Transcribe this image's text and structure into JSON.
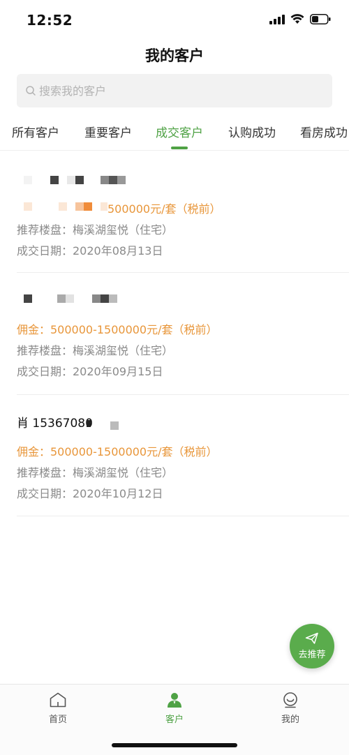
{
  "status_bar": {
    "time": "12:52",
    "icons": [
      "signal-icon",
      "wifi-icon",
      "battery-icon"
    ]
  },
  "header": {
    "title": "我的客户"
  },
  "search": {
    "placeholder": "搜索我的客户",
    "value": ""
  },
  "tabs": [
    {
      "label": "所有客户",
      "active": false
    },
    {
      "label": "重要客户",
      "active": false
    },
    {
      "label": "成交客户",
      "active": true
    },
    {
      "label": "认购成功",
      "active": false
    },
    {
      "label": "看房成功",
      "active": false
    }
  ],
  "customers": [
    {
      "name": "",
      "commission": "500000元/套（税前）",
      "project": "推荐楼盘：梅溪湖玺悦（住宅）",
      "date": "成交日期：2020年08月13日"
    },
    {
      "name": "",
      "commission": "佣金：500000-1500000元/套（税前）",
      "project": "推荐楼盘：梅溪湖玺悦（住宅）",
      "date": "成交日期：2020年09月15日"
    },
    {
      "name": "肖  15367080",
      "commission": "佣金：500000-1500000元/套（税前）",
      "project": "推荐楼盘：梅溪湖玺悦（住宅）",
      "date": "成交日期：2020年10月12日"
    }
  ],
  "fab": {
    "label": "去推荐",
    "icon": "send-icon"
  },
  "tabbar": [
    {
      "label": "首页",
      "icon": "home-icon",
      "active": false
    },
    {
      "label": "客户",
      "icon": "user-icon",
      "active": true
    },
    {
      "label": "我的",
      "icon": "face-icon",
      "active": false
    }
  ],
  "colors": {
    "accent": "#4fa245",
    "commission": "#e8963a",
    "secondary_text": "#8a8a8a"
  }
}
